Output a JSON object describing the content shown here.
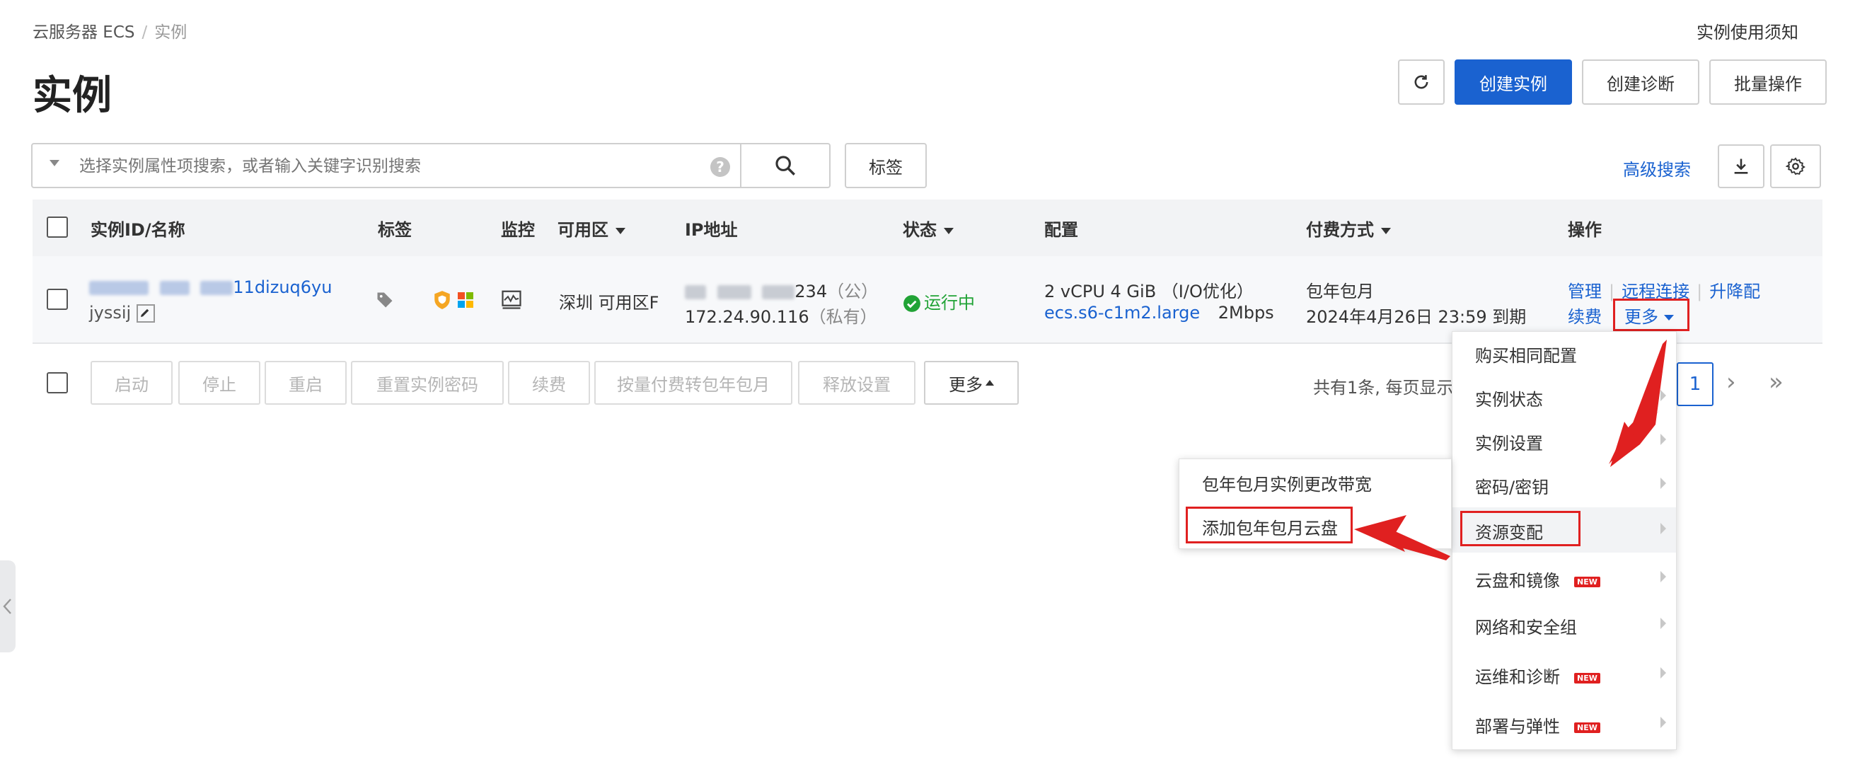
{
  "breadcrumb": {
    "root": "云服务器 ECS",
    "separator": "/",
    "current": "实例"
  },
  "header": {
    "title": "实例",
    "notice_link": "实例使用须知"
  },
  "toolbar": {
    "create_instance": "创建实例",
    "create_diagnosis": "创建诊断",
    "batch_ops": "批量操作"
  },
  "search": {
    "placeholder": "选择实例属性项搜索，或者输入关键字识别搜索",
    "tag_button": "标签",
    "advanced": "高级搜索"
  },
  "table": {
    "headers": [
      "实例ID/名称",
      "标签",
      "监控",
      "可用区",
      "IP地址",
      "状态",
      "配置",
      "付费方式",
      "操作"
    ],
    "row": {
      "id_suffix": "11dizuq6yu",
      "name_prefix": "jyssij",
      "zone": "深圳 可用区F",
      "public_ip_suffix": "234",
      "public_ip_note": "（公）",
      "private_ip": "172.24.90.116",
      "private_ip_note": "（私有）",
      "status": "运行中",
      "config_line1": "2 vCPU 4 GiB （I/O优化）",
      "config_type": "ecs.s6-c1m2.large",
      "config_bandwidth": "2Mbps",
      "billing": "包年包月",
      "expire": "2024年4月26日 23:59 到期",
      "ops": [
        "管理",
        "远程连接",
        "升降配",
        "续费",
        "更多"
      ]
    }
  },
  "bulk_actions": [
    "启动",
    "停止",
    "重启",
    "重置实例密码",
    "续费",
    "按量付费转包年包月",
    "释放设置"
  ],
  "bulk_more": "更多",
  "pagination": {
    "summary": "共有1条, 每页显示",
    "current_page": "1"
  },
  "more_menu": {
    "items": [
      {
        "label": "购买相同配置",
        "new": false
      },
      {
        "label": "实例状态",
        "new": false
      },
      {
        "label": "实例设置",
        "new": false
      },
      {
        "label": "密码/密钥",
        "new": false
      },
      {
        "label": "资源变配",
        "new": false
      },
      {
        "label": "云盘和镜像",
        "new": true
      },
      {
        "label": "网络和安全组",
        "new": false
      },
      {
        "label": "运维和诊断",
        "new": true
      },
      {
        "label": "部署与弹性",
        "new": true
      }
    ],
    "badge": "NEW"
  },
  "submenu": {
    "items": [
      "包年包月实例更改带宽",
      "添加包年包月云盘"
    ]
  },
  "colors": {
    "primary": "#1a62d0",
    "success": "#21a336",
    "highlight": "#e02020"
  }
}
